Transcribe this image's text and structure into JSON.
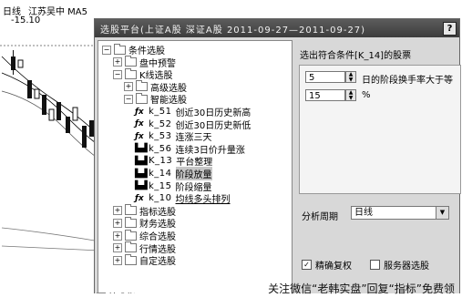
{
  "chart": {
    "label1": "日线",
    "label2": "江苏吴中 MA5",
    "price": "-15.10"
  },
  "dialog": {
    "title": "选股平台(上证A股 深证A股  2011-09-27—2011-09-27)",
    "help": "?"
  },
  "tree": [
    {
      "text": "条件选股",
      "exp": "−"
    },
    {
      "text": "盘中预警",
      "exp": "+"
    },
    {
      "text": "K线选股",
      "exp": "−"
    },
    {
      "text": "高级选股",
      "exp": "+"
    },
    {
      "text": "智能选股",
      "exp": "−"
    },
    {
      "icon": "fx",
      "code": "k_51",
      "text": "创近30日历史新高"
    },
    {
      "icon": "fx",
      "code": "k_52",
      "text": "创近30日历史新低"
    },
    {
      "icon": "fx",
      "code": "k_53",
      "text": "连涨三天"
    },
    {
      "icon": "bars",
      "code": "k_56",
      "text": "连续3日价升量涨"
    },
    {
      "icon": "bars",
      "code": "K_13",
      "text": "平台整理"
    },
    {
      "icon": "bars",
      "code": "k_14",
      "text": "阶段放量"
    },
    {
      "icon": "bars",
      "code": "k_15",
      "text": "阶段缩量"
    },
    {
      "icon": "fx",
      "code": "k_10",
      "text": "均线多头排列"
    },
    {
      "text": "指标选股",
      "exp": "+"
    },
    {
      "text": "财务选股",
      "exp": "+"
    },
    {
      "text": "综合选股",
      "exp": "+"
    },
    {
      "text": "行情选股",
      "exp": "+"
    },
    {
      "text": "自定选股",
      "exp": "+"
    }
  ],
  "tree_more": "技术指",
  "icons": {
    "fx": "ƒx",
    "bars": "▙▟"
  },
  "right": {
    "heading": "选出符合条件[K_14]的股票",
    "param1": {
      "value": "5",
      "label": "日的阶段换手率大于等"
    },
    "param2": {
      "value": "15",
      "label": "%"
    },
    "period_label": "分析周期",
    "period_value": "日线",
    "check1": {
      "label": "精确复权",
      "checked": true
    },
    "check2": {
      "label": "服务器选股",
      "checked": false
    }
  },
  "footer": "关注微信“老韩实盘”回复“指标”免费领"
}
